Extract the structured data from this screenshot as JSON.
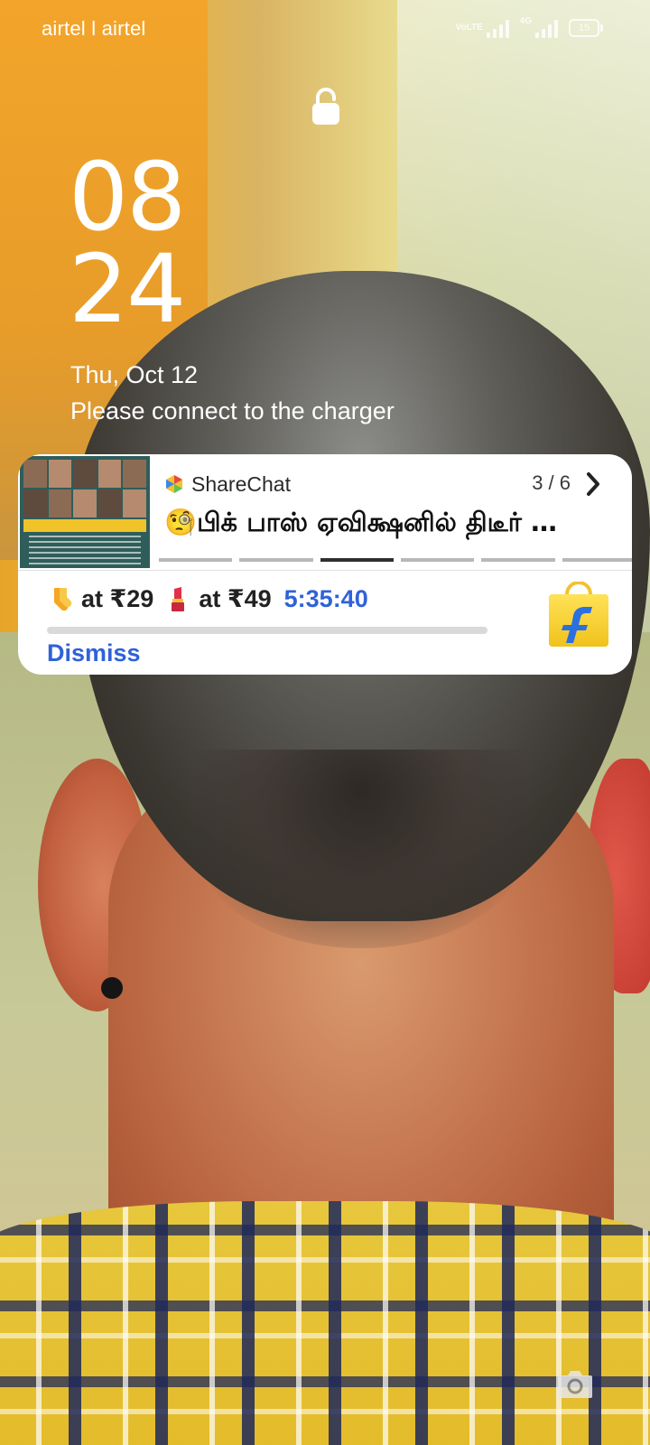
{
  "status_bar": {
    "carrier": "airtel l airtel",
    "volte_label": "VoLTE",
    "network_label": "4G",
    "battery_level": "15"
  },
  "lockscreen": {
    "clock_hours": "08",
    "clock_minutes": "24",
    "date": "Thu, Oct 12",
    "charger_message": "Please connect to the charger"
  },
  "notification": {
    "sharechat": {
      "app_name": "ShareChat",
      "counter": "3 / 6",
      "title": "🧐பிக் பாஸ் ஏவிக்ஷனில் திடீர் …",
      "progress_total": 6,
      "progress_active": 3
    },
    "flipkart": {
      "item1_icon": "socks-icon",
      "item1_price": "at ₹29",
      "item2_icon": "lipstick-icon",
      "item2_price": "at ₹49",
      "timer": "5:35:40",
      "dismiss_label": "Dismiss"
    }
  },
  "colors": {
    "accent_blue": "#2f62d9",
    "card_bg": "#ffffff"
  }
}
